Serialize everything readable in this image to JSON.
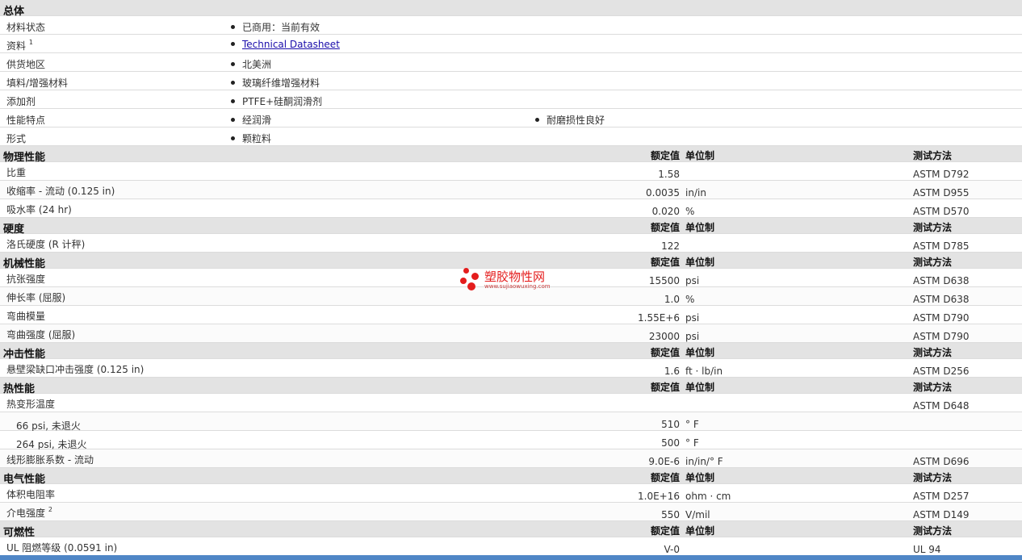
{
  "general": {
    "title": "总体",
    "rows": [
      {
        "label": "材料状态",
        "v1": "已商用：当前有效"
      },
      {
        "label": "资料",
        "sup": "1",
        "v1": "Technical Datasheet",
        "link": true
      },
      {
        "label": "供货地区",
        "v1": "北美洲"
      },
      {
        "label": "填料/增强材料",
        "v1": "玻璃纤维增强材料"
      },
      {
        "label": "添加剂",
        "v1": "PTFE+硅酮润滑剂"
      },
      {
        "label": "性能特点",
        "v1": "经润滑",
        "v2": "耐磨损性良好"
      },
      {
        "label": "形式",
        "v1": "颗粒料"
      }
    ]
  },
  "columns": {
    "value": "额定值",
    "unit": "单位制",
    "test": "测试方法"
  },
  "sections": [
    {
      "title": "物理性能",
      "rows": [
        {
          "label": "比重",
          "paren": "",
          "value": "1.58",
          "unit": "",
          "test": "ASTM D792"
        },
        {
          "label": "收缩率 - 流动",
          "paren": "(0.125 in)",
          "value": "0.0035",
          "unit": "in/in",
          "test": "ASTM D955"
        },
        {
          "label": "吸水率",
          "paren": "(24 hr)",
          "value": "0.020",
          "unit": "%",
          "test": "ASTM D570"
        }
      ]
    },
    {
      "title": "硬度",
      "rows": [
        {
          "label": "洛氏硬度",
          "paren": "(R 计秤)",
          "value": "122",
          "unit": "",
          "test": "ASTM D785"
        }
      ]
    },
    {
      "title": "机械性能",
      "rows": [
        {
          "label": "抗张强度",
          "paren": "",
          "value": "15500",
          "unit": "psi",
          "test": "ASTM D638"
        },
        {
          "label": "伸长率",
          "paren": "(屈服)",
          "value": "1.0",
          "unit": "%",
          "test": "ASTM D638"
        },
        {
          "label": "弯曲模量",
          "paren": "",
          "value": "1.55E+6",
          "unit": "psi",
          "test": "ASTM D790"
        },
        {
          "label": "弯曲强度",
          "paren": "(屈服)",
          "value": "23000",
          "unit": "psi",
          "test": "ASTM D790"
        }
      ]
    },
    {
      "title": "冲击性能",
      "rows": [
        {
          "label": "悬壁梁缺口冲击强度",
          "paren": "(0.125 in)",
          "value": "1.6",
          "unit": "ft · lb/in",
          "test": "ASTM D256"
        }
      ]
    },
    {
      "title": "热性能",
      "rows": [
        {
          "label": "热变形温度",
          "paren": "",
          "value": "",
          "unit": "",
          "test": "ASTM D648"
        },
        {
          "label": "66 psi, 未退火",
          "paren": "",
          "value": "510",
          "unit": "° F",
          "test": "",
          "sub": true
        },
        {
          "label": "264 psi, 未退火",
          "paren": "",
          "value": "500",
          "unit": "° F",
          "test": "",
          "sub": true
        },
        {
          "label": "线形膨胀系数 - 流动",
          "paren": "",
          "value": "9.0E-6",
          "unit": "in/in/° F",
          "test": "ASTM D696"
        }
      ]
    },
    {
      "title": "电气性能",
      "rows": [
        {
          "label": "体积电阻率",
          "paren": "",
          "value": "1.0E+16",
          "unit": "ohm · cm",
          "test": "ASTM D257"
        },
        {
          "label": "介电强度",
          "sup": "2",
          "paren": "",
          "value": "550",
          "unit": "V/mil",
          "test": "ASTM D149"
        }
      ]
    },
    {
      "title": "可燃性",
      "rows": [
        {
          "label": "UL 阻燃等级",
          "paren": "(0.0591 in)",
          "value": "V-0",
          "unit": "",
          "test": "UL 94"
        }
      ]
    }
  ],
  "watermark": {
    "name": "塑胶物性网",
    "url": "www.sujiaowuxing.com"
  }
}
